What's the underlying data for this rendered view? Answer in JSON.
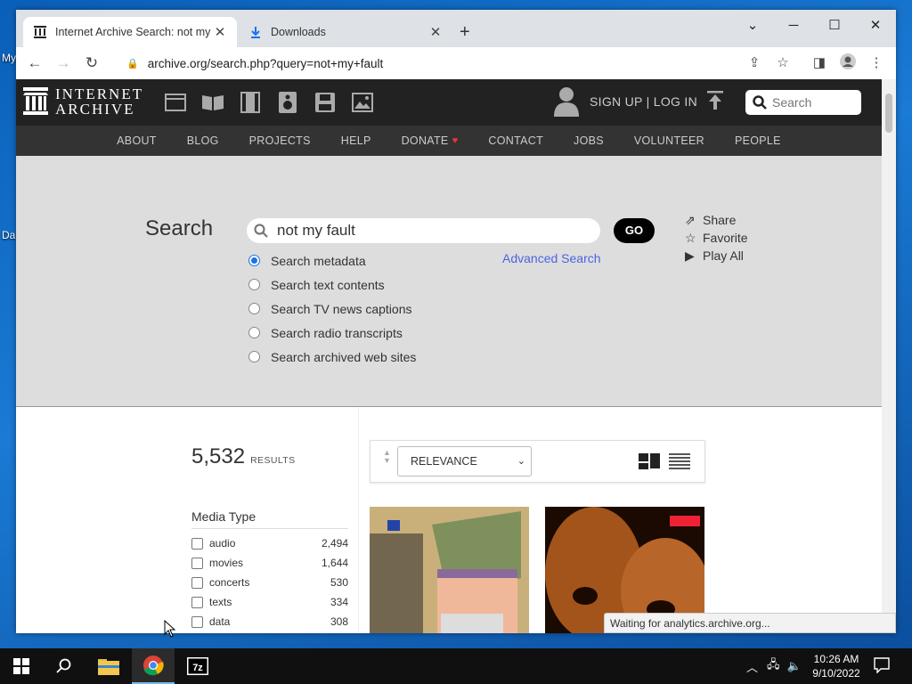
{
  "desktop": {
    "icon_labels": [
      "My",
      "Da"
    ]
  },
  "browser": {
    "tabs": [
      {
        "title": "Internet Archive Search: not my f",
        "active": true
      },
      {
        "title": "Downloads",
        "active": false
      }
    ],
    "url": "archive.org/search.php?query=not+my+fault",
    "status": "Waiting for analytics.archive.org..."
  },
  "ia": {
    "logo_line1": "INTERNET",
    "logo_line2": "ARCHIVE",
    "media_icons": [
      "web-icon",
      "texts-icon",
      "video-icon",
      "audio-icon",
      "software-icon",
      "images-icon"
    ],
    "signup": "SIGN UP | LOG IN",
    "search_placeholder": "Search",
    "nav": [
      "ABOUT",
      "BLOG",
      "PROJECTS",
      "HELP",
      "DONATE",
      "CONTACT",
      "JOBS",
      "VOLUNTEER",
      "PEOPLE"
    ],
    "heart_color": "#e33333"
  },
  "search": {
    "label": "Search",
    "query": "not my fault",
    "go": "GO",
    "advanced": "Advanced Search",
    "options": [
      {
        "label": "Search metadata",
        "checked": true
      },
      {
        "label": "Search text contents",
        "checked": false
      },
      {
        "label": "Search TV news captions",
        "checked": false
      },
      {
        "label": "Search radio transcripts",
        "checked": false
      },
      {
        "label": "Search archived web sites",
        "checked": false
      }
    ],
    "actions": [
      "Share",
      "Favorite",
      "Play All"
    ]
  },
  "results": {
    "count": "5,532",
    "count_label": "RESULTS",
    "sort": "RELEVANCE",
    "media_type_heading": "Media Type",
    "facets": [
      {
        "name": "audio",
        "count": "2,494"
      },
      {
        "name": "movies",
        "count": "1,644"
      },
      {
        "name": "concerts",
        "count": "530"
      },
      {
        "name": "texts",
        "count": "334"
      },
      {
        "name": "data",
        "count": "308"
      }
    ]
  },
  "taskbar": {
    "time": "10:26 AM",
    "date": "9/10/2022"
  }
}
